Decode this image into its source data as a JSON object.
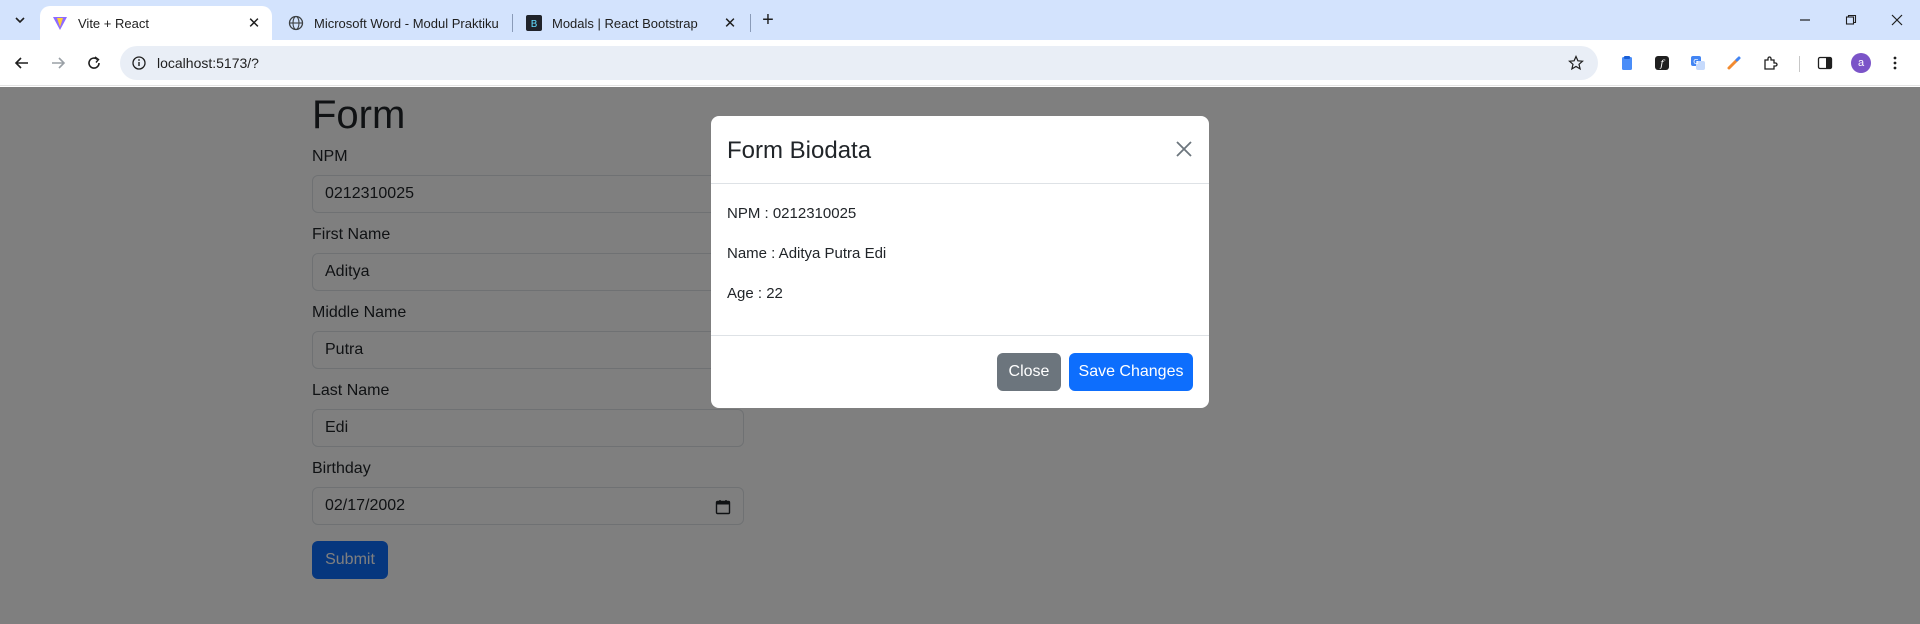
{
  "browser": {
    "tabs": [
      {
        "title": "Vite + React",
        "favicon": "vite-logo",
        "active": true
      },
      {
        "title": "Microsoft Word - Modul Praktiku",
        "favicon": "globe-icon",
        "active": false
      },
      {
        "title": "Modals | React Bootstrap",
        "favicon": "react-bootstrap-logo",
        "active": false
      }
    ],
    "url": "localhost:5173/?",
    "profile_initial": "a",
    "accent_color": "#d3e3fd"
  },
  "page": {
    "title": "Form",
    "fields": [
      {
        "label": "NPM",
        "value": "0212310025"
      },
      {
        "label": "First Name",
        "value": "Aditya"
      },
      {
        "label": "Middle Name",
        "value": "Putra"
      },
      {
        "label": "Last Name",
        "value": "Edi"
      },
      {
        "label": "Birthday",
        "value": "02/17/2002"
      }
    ],
    "submit_label": "Submit",
    "primary_color": "#0d6efd"
  },
  "modal": {
    "title": "Form Biodata",
    "lines": [
      "NPM : 0212310025",
      "Name : Aditya Putra Edi",
      "Age : 22"
    ],
    "close_label": "Close",
    "save_label": "Save Changes",
    "secondary_color": "#6c757d"
  }
}
